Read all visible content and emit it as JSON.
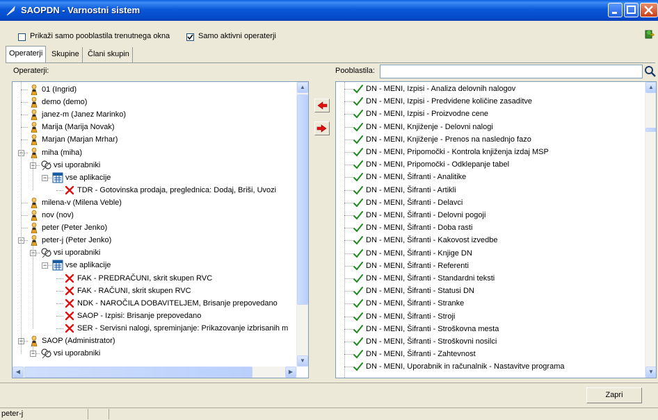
{
  "window": {
    "title": "SAOPDN - Varnostni sistem"
  },
  "options": {
    "only_current_window": {
      "label": "Prikaži samo pooblastila trenutnega okna",
      "checked": false
    },
    "only_active_operators": {
      "label": "Samo aktivni operaterji",
      "checked": true
    }
  },
  "tabs": [
    {
      "label": "Operaterji",
      "active": true
    },
    {
      "label": "Skupine",
      "active": false
    },
    {
      "label": "Člani skupin",
      "active": false
    }
  ],
  "left": {
    "label": "Operaterji:",
    "rows": [
      {
        "text": "01 (Ingrid)",
        "level": 0,
        "icon": "user-icon",
        "expander": ""
      },
      {
        "text": "demo (demo)",
        "level": 0,
        "icon": "user-icon",
        "expander": ""
      },
      {
        "text": "janez-m (Janez Marinko)",
        "level": 0,
        "icon": "user-icon",
        "expander": ""
      },
      {
        "text": "Marija (Marija Novak)",
        "level": 0,
        "icon": "user-icon",
        "expander": ""
      },
      {
        "text": "Marjan (Marjan Mrhar)",
        "level": 0,
        "icon": "user-icon",
        "expander": ""
      },
      {
        "text": "miha (miha)",
        "level": 0,
        "icon": "user-icon",
        "expander": "minus"
      },
      {
        "text": "vsi uporabniki",
        "level": 1,
        "icon": "group-icon",
        "expander": "minus"
      },
      {
        "text": "vse aplikacije",
        "level": 2,
        "icon": "apps-icon",
        "expander": "minus"
      },
      {
        "text": "TDR - Gotovinska prodaja, preglednica: Dodaj, Briši, Uvozi",
        "level": 3,
        "icon": "deny-icon",
        "expander": ""
      },
      {
        "text": "milena-v (Milena Veble)",
        "level": 0,
        "icon": "user-icon",
        "expander": ""
      },
      {
        "text": "nov (nov)",
        "level": 0,
        "icon": "user-icon",
        "expander": ""
      },
      {
        "text": "peter (Peter Jenko)",
        "level": 0,
        "icon": "user-icon",
        "expander": ""
      },
      {
        "text": "peter-j (Peter Jenko)",
        "level": 0,
        "icon": "user-icon",
        "expander": "minus"
      },
      {
        "text": "vsi uporabniki",
        "level": 1,
        "icon": "group-icon",
        "expander": "minus"
      },
      {
        "text": "vse aplikacije",
        "level": 2,
        "icon": "apps-icon",
        "expander": "minus"
      },
      {
        "text": "FAK - PREDRAČUNI, skrit skupen RVC",
        "level": 3,
        "icon": "deny-icon",
        "expander": ""
      },
      {
        "text": "FAK - RAČUNI, skrit skupen RVC",
        "level": 3,
        "icon": "deny-icon",
        "expander": ""
      },
      {
        "text": "NDK - NAROČILA DOBAVITELJEM, Brisanje prepovedano",
        "level": 3,
        "icon": "deny-icon",
        "expander": ""
      },
      {
        "text": "SAOP - Izpisi: Brisanje prepovedano",
        "level": 3,
        "icon": "deny-icon",
        "expander": ""
      },
      {
        "text": "SER - Servisni nalogi, spreminjanje: Prikazovanje izbrisanih m",
        "level": 3,
        "icon": "deny-icon",
        "expander": ""
      },
      {
        "text": "SAOP (Administrator)",
        "level": 0,
        "icon": "user-icon",
        "expander": "minus"
      },
      {
        "text": "vsi uporabniki",
        "level": 1,
        "icon": "group-icon",
        "expander": "minus"
      }
    ]
  },
  "right": {
    "label": "Pooblastila:",
    "search_value": "",
    "rows": [
      "DN - MENI, Izpisi - Analiza delovnih nalogov",
      "DN - MENI, Izpisi - Predvidene količine zasaditve",
      "DN - MENI, Izpisi - Proizvodne cene",
      "DN - MENI, Knjiženje - Delovni nalogi",
      "DN - MENI, Knjiženje - Prenos na naslednjo fazo",
      "DN - MENI, Pripomočki - Kontrola knjiženja izdaj  MSP",
      "DN - MENI, Pripomočki - Odklepanje tabel",
      "DN - MENI, Šifranti - Analitike",
      "DN - MENI, Šifranti - Artikli",
      "DN - MENI, Šifranti - Delavci",
      "DN - MENI, Šifranti - Delovni pogoji",
      "DN - MENI, Šifranti - Doba rasti",
      "DN - MENI, Šifranti - Kakovost izvedbe",
      "DN - MENI, Šifranti - Knjige DN",
      "DN - MENI, Šifranti - Referenti",
      "DN - MENI, Šifranti - Standardni teksti",
      "DN - MENI, Šifranti - Statusi DN",
      "DN - MENI, Šifranti - Stranke",
      "DN - MENI, Šifranti - Stroji",
      "DN - MENI, Šifranti - Stroškovna mesta",
      "DN - MENI, Šifranti - Stroškovni nosilci",
      "DN - MENI, Šifranti - Zahtevnost",
      "DN - MENI, Uporabnik in računalnik - Nastavitve programa"
    ]
  },
  "buttons": {
    "close": "Zapri"
  },
  "status": {
    "user": "peter-j"
  },
  "colors": {
    "title_bar": "#0a58d8",
    "deny": "#e01010",
    "allow": "#1d8a1d"
  }
}
